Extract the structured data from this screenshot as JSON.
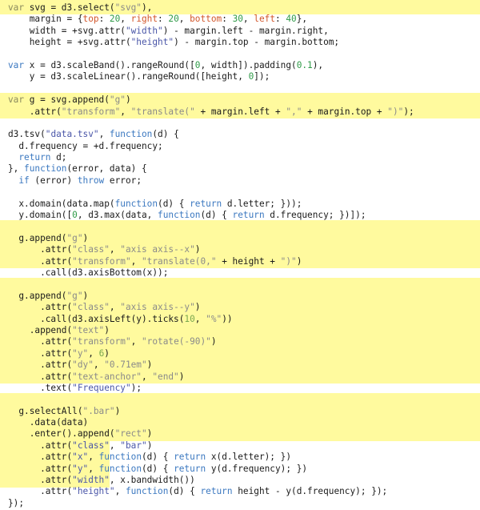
{
  "editor": {
    "language": "javascript",
    "highlight_color": "#fffa9e",
    "colors": {
      "keyword": "#3b78c0",
      "string": "#4a56a8",
      "number": "#2f9a48",
      "object_key": "#d2562a",
      "plain": "#1a1a1a",
      "dimmed_string": "#8a8a8a",
      "dimmed_keyword": "#8b8a5e"
    },
    "highlighted_ranges": [
      {
        "from_line": 1,
        "to_line": 1
      },
      {
        "from_line": 9,
        "to_line": 10
      },
      {
        "from_line": 20,
        "to_line": 23
      },
      {
        "from_line": 25,
        "to_line": 33
      },
      {
        "from_line": 35,
        "to_line": 38
      },
      {
        "from_line": 39,
        "to_line": 42,
        "partial": true
      }
    ],
    "lines": [
      "var svg = d3.select(\"svg\"),",
      "    margin = {top: 20, right: 20, bottom: 30, left: 40},",
      "    width = +svg.attr(\"width\") - margin.left - margin.right,",
      "    height = +svg.attr(\"height\") - margin.top - margin.bottom;",
      "",
      "var x = d3.scaleBand().rangeRound([0, width]).padding(0.1),",
      "    y = d3.scaleLinear().rangeRound([height, 0]);",
      "",
      "var g = svg.append(\"g\")",
      "    .attr(\"transform\", \"translate(\" + margin.left + \",\" + margin.top + \")\");",
      "",
      "d3.tsv(\"data.tsv\", function(d) {",
      "  d.frequency = +d.frequency;",
      "  return d;",
      "}, function(error, data) {",
      "  if (error) throw error;",
      "",
      "  x.domain(data.map(function(d) { return d.letter; }));",
      "  y.domain([0, d3.max(data, function(d) { return d.frequency; })]);",
      "",
      "  g.append(\"g\")",
      "      .attr(\"class\", \"axis axis--x\")",
      "      .attr(\"transform\", \"translate(0,\" + height + \")\")",
      "      .call(d3.axisBottom(x));",
      "",
      "  g.append(\"g\")",
      "      .attr(\"class\", \"axis axis--y\")",
      "      .call(d3.axisLeft(y).ticks(10, \"%\"))",
      "    .append(\"text\")",
      "      .attr(\"transform\", \"rotate(-90)\")",
      "      .attr(\"y\", 6)",
      "      .attr(\"dy\", \"0.71em\")",
      "      .attr(\"text-anchor\", \"end\")",
      "      .text(\"Frequency\");",
      "",
      "  g.selectAll(\".bar\")",
      "    .data(data)",
      "    .enter().append(\"rect\")",
      "      .attr(\"class\", \"bar\")",
      "      .attr(\"x\", function(d) { return x(d.letter); })",
      "      .attr(\"y\", function(d) { return y(d.frequency); })",
      "      .attr(\"width\", x.bandwidth())",
      "      .attr(\"height\", function(d) { return height - y(d.frequency); });",
      "});"
    ]
  }
}
